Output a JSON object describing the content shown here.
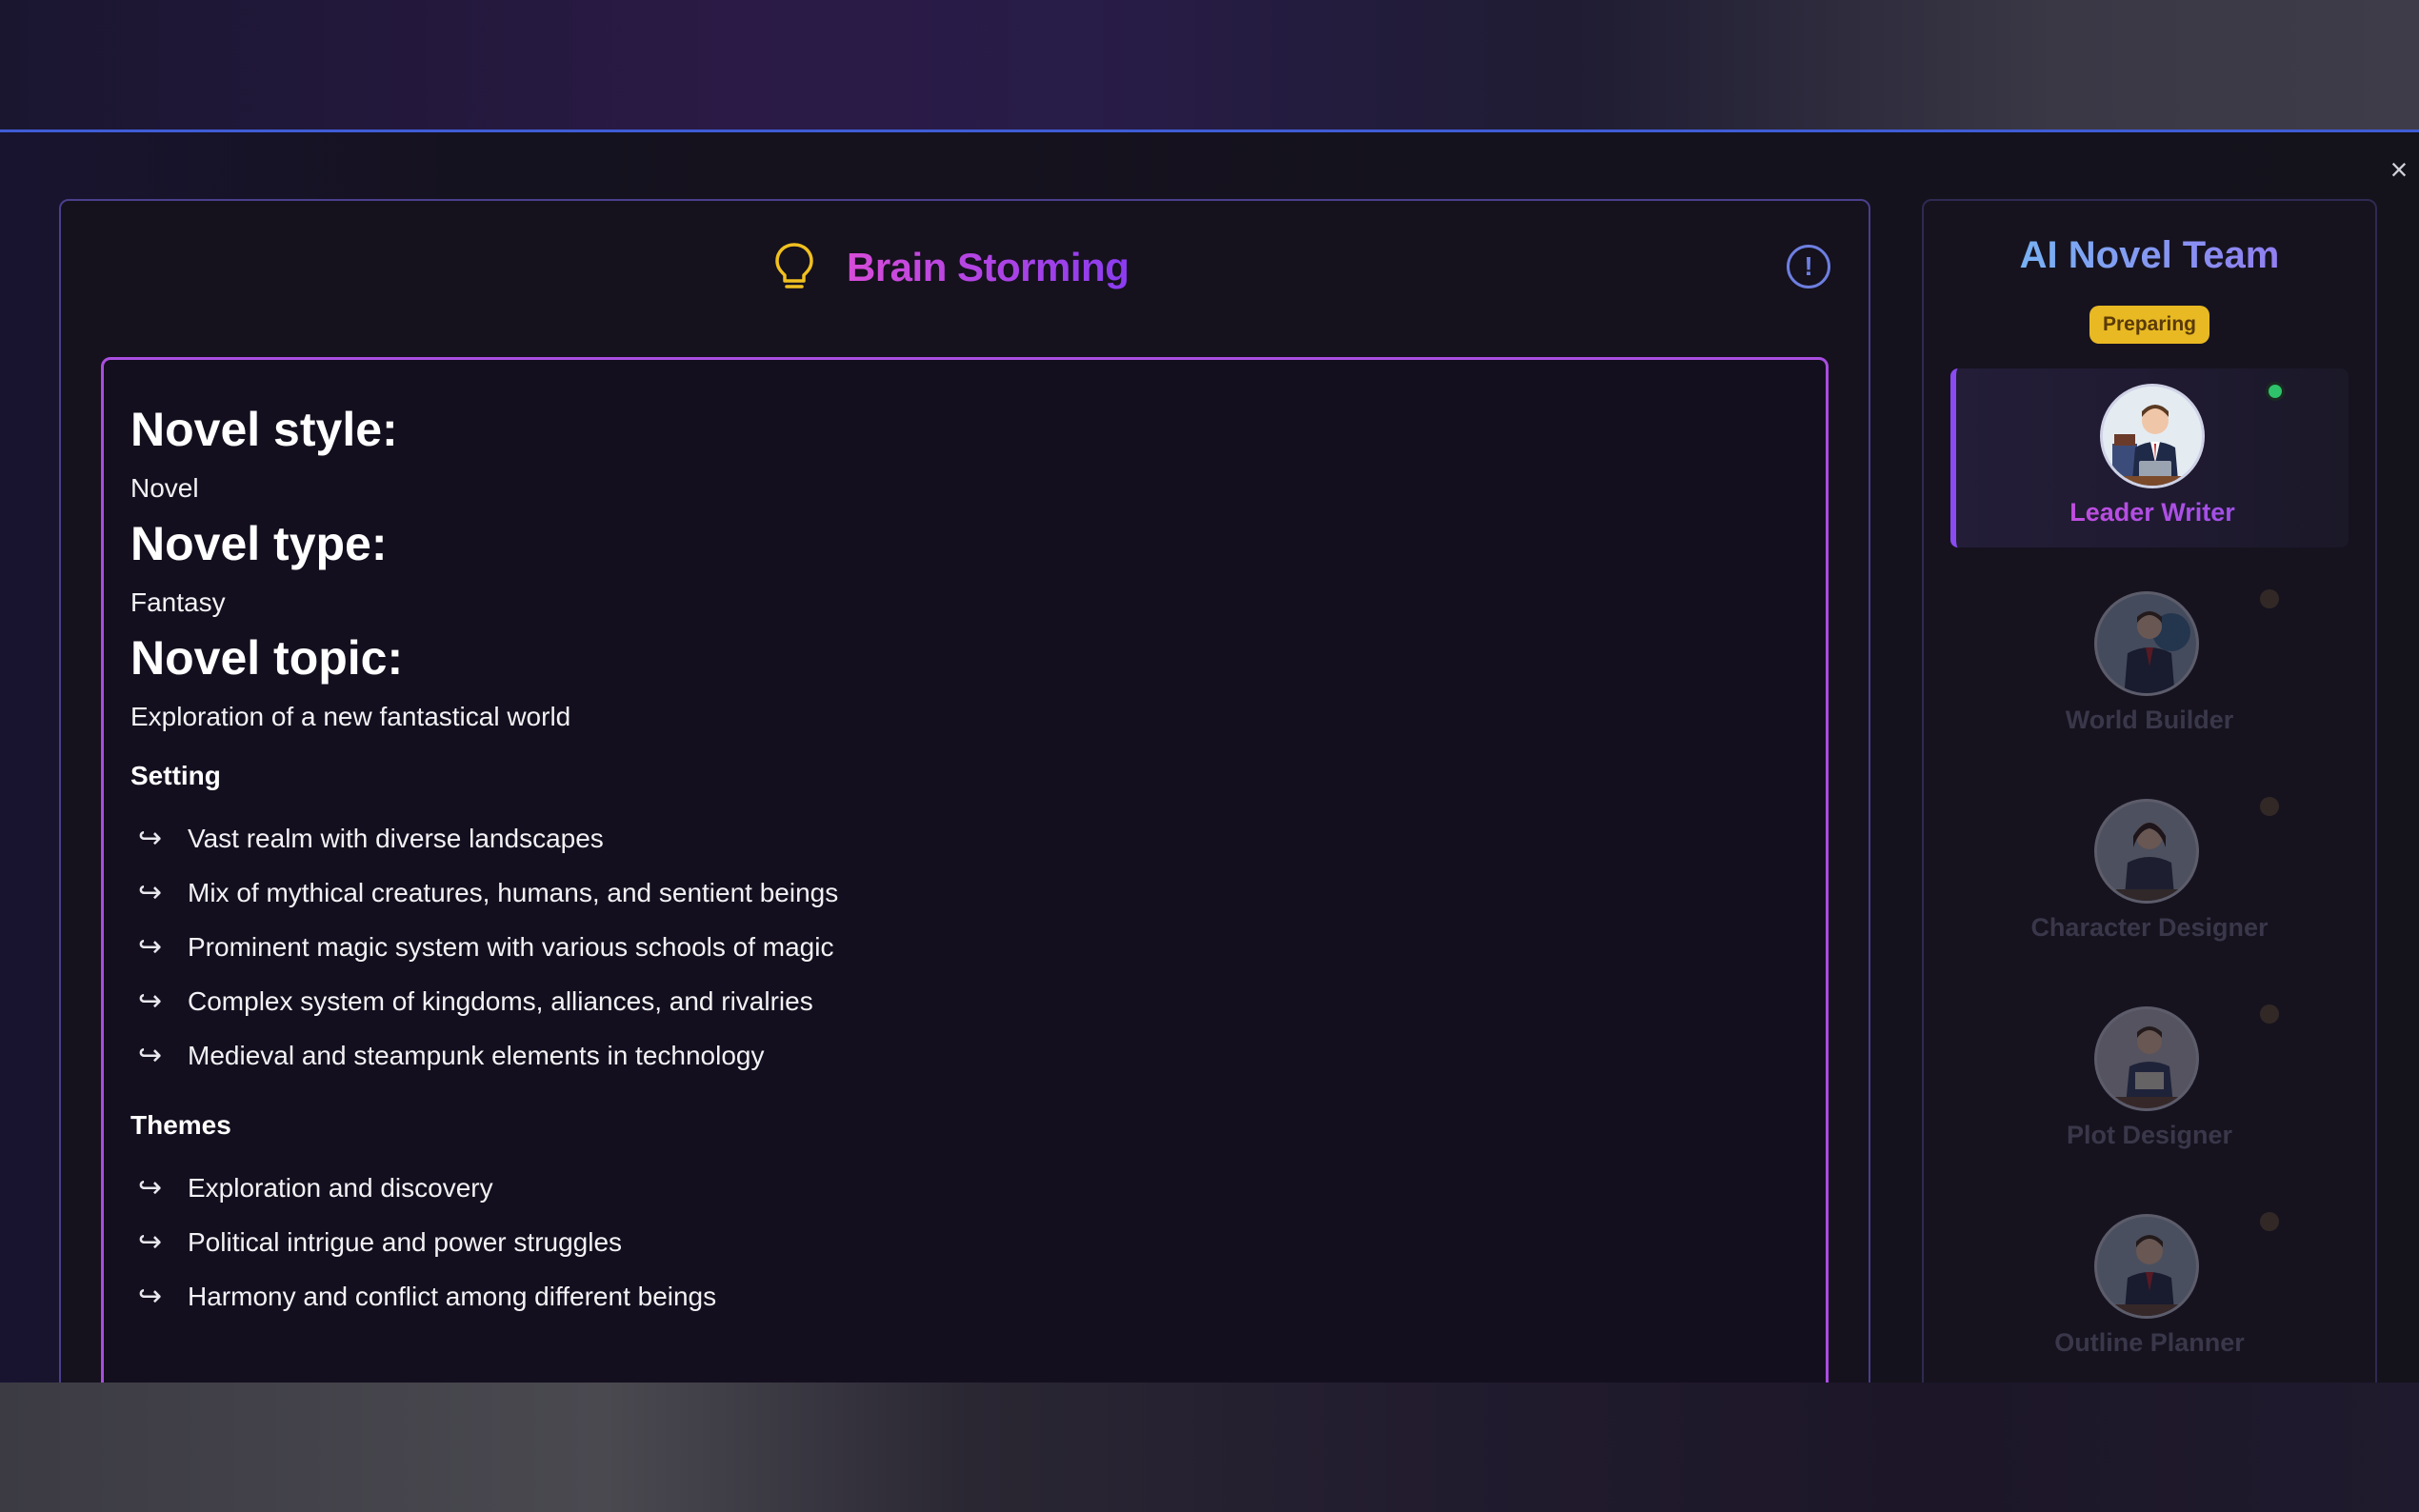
{
  "modal": {
    "close_label": "×"
  },
  "brainstorm": {
    "title": "Brain Storming",
    "sections": [
      {
        "heading": "Novel style:",
        "value": "Novel"
      },
      {
        "heading": "Novel type:",
        "value": "Fantasy"
      },
      {
        "heading": "Novel topic:",
        "value": "Exploration of a new fantastical world"
      }
    ],
    "setting": {
      "heading": "Setting",
      "items": [
        "Vast realm with diverse landscapes",
        "Mix of mythical creatures, humans, and sentient beings",
        "Prominent magic system with various schools of magic",
        "Complex system of kingdoms, alliances, and rivalries",
        "Medieval and steampunk elements in technology"
      ]
    },
    "themes": {
      "heading": "Themes",
      "items": [
        "Exploration and discovery",
        "Political intrigue and power struggles",
        "Harmony and conflict among different beings"
      ]
    }
  },
  "team": {
    "title": "AI Novel Team",
    "status": "Preparing",
    "members": [
      {
        "name": "Leader Writer",
        "active": true
      },
      {
        "name": "World Builder",
        "active": false
      },
      {
        "name": "Character Designer",
        "active": false
      },
      {
        "name": "Plot Designer",
        "active": false
      },
      {
        "name": "Outline Planner",
        "active": false
      }
    ]
  },
  "colors": {
    "accent_purple": "#a94ee0",
    "accent_blue": "#3f5dd6",
    "status_yellow": "#e8b923",
    "online_green": "#2ec26b"
  }
}
